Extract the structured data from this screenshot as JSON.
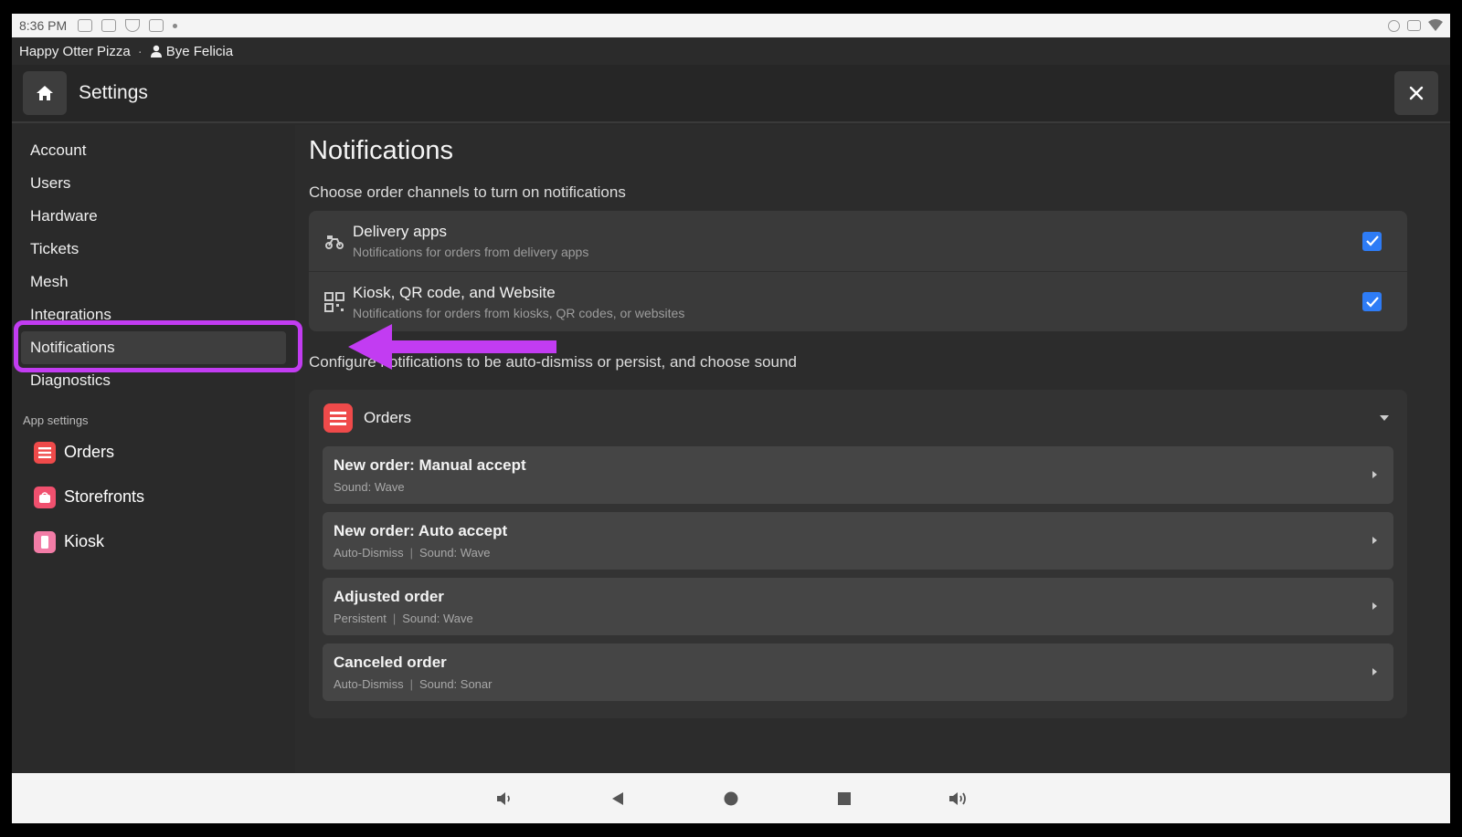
{
  "status_bar": {
    "time": "8:36 PM"
  },
  "info_bar": {
    "restaurant": "Happy Otter Pizza",
    "separator": "·",
    "user": "Bye Felicia"
  },
  "header": {
    "title": "Settings"
  },
  "sidebar": {
    "items": [
      {
        "label": "Account"
      },
      {
        "label": "Users"
      },
      {
        "label": "Hardware"
      },
      {
        "label": "Tickets"
      },
      {
        "label": "Mesh"
      },
      {
        "label": "Integrations"
      },
      {
        "label": "Notifications"
      },
      {
        "label": "Diagnostics"
      }
    ],
    "section_label": "App settings",
    "apps": [
      {
        "label": "Orders",
        "color": "#ef4a4a"
      },
      {
        "label": "Storefronts",
        "color": "#f0506e"
      },
      {
        "label": "Kiosk",
        "color": "#f27ca6"
      }
    ]
  },
  "main": {
    "title": "Notifications",
    "channels_subtitle": "Choose order channels to turn on notifications",
    "channels": [
      {
        "title": "Delivery apps",
        "description": "Notifications for orders from delivery apps",
        "checked": true
      },
      {
        "title": "Kiosk, QR code, and Website",
        "description": "Notifications for orders from kiosks, QR codes, or websites",
        "checked": true
      }
    ],
    "configure_subtitle": "Configure notifications to be auto-dismiss or persist, and choose sound",
    "orders_group": {
      "title": "Orders",
      "rows": [
        {
          "title": "New order: Manual accept",
          "meta1": "Sound: Wave",
          "meta2": ""
        },
        {
          "title": "New order: Auto accept",
          "meta1": "Auto-Dismiss",
          "meta2": "Sound: Wave"
        },
        {
          "title": "Adjusted order",
          "meta1": "Persistent",
          "meta2": "Sound: Wave"
        },
        {
          "title": "Canceled order",
          "meta1": "Auto-Dismiss",
          "meta2": "Sound: Sonar"
        }
      ]
    }
  },
  "colors": {
    "accent_checkbox": "#2e7cf6",
    "highlight": "#c23cf2"
  }
}
